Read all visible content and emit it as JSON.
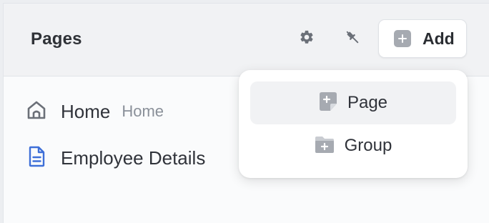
{
  "header": {
    "title": "Pages",
    "settings_icon": "gear-icon",
    "pin_icon": "pin-icon",
    "add_label": "Add"
  },
  "nav": {
    "items": [
      {
        "label": "Home",
        "sub": "Home",
        "icon": "home-icon"
      },
      {
        "label": "Employee Details",
        "icon": "document-icon"
      }
    ]
  },
  "add_menu": {
    "items": [
      {
        "label": "Page",
        "icon": "page-plus-icon"
      },
      {
        "label": "Group",
        "icon": "folder-plus-icon"
      }
    ]
  },
  "colors": {
    "doc_icon": "#3e6fd8",
    "icon_gray": "#6b7078"
  }
}
